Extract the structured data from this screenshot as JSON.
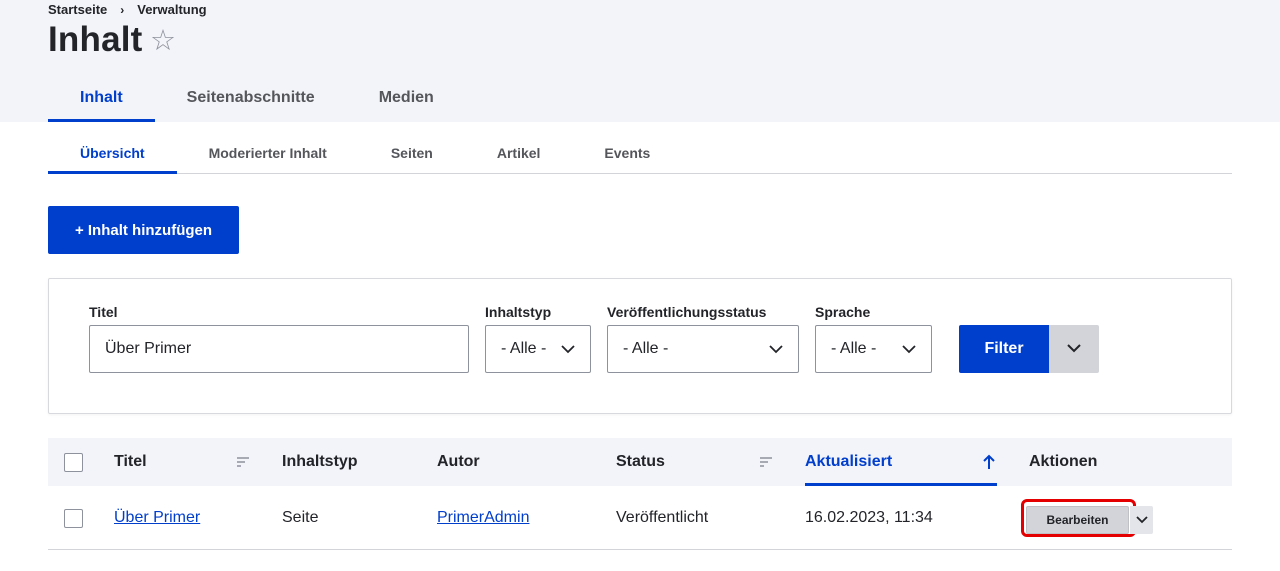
{
  "breadcrumb": {
    "home": "Startseite",
    "separator": "›",
    "current": "Verwaltung"
  },
  "page": {
    "title": "Inhalt",
    "star_glyph": "☆"
  },
  "primary_tabs": [
    {
      "label": "Inhalt",
      "active": true
    },
    {
      "label": "Seitenabschnitte",
      "active": false
    },
    {
      "label": "Medien",
      "active": false
    }
  ],
  "secondary_tabs": [
    {
      "label": "Übersicht",
      "active": true
    },
    {
      "label": "Moderierter Inhalt",
      "active": false
    },
    {
      "label": "Seiten",
      "active": false
    },
    {
      "label": "Artikel",
      "active": false
    },
    {
      "label": "Events",
      "active": false
    }
  ],
  "add_button": {
    "label": "+ Inhalt hinzufügen"
  },
  "filters": {
    "title": {
      "label": "Titel",
      "value": "Über Primer"
    },
    "type": {
      "label": "Inhaltstyp",
      "value": "- Alle -"
    },
    "status": {
      "label": "Veröffentlichungsstatus",
      "value": "- Alle -"
    },
    "language": {
      "label": "Sprache",
      "value": "- Alle -"
    },
    "submit_label": "Filter"
  },
  "table": {
    "columns": {
      "title": "Titel",
      "type": "Inhaltstyp",
      "author": "Autor",
      "status": "Status",
      "updated": "Aktualisiert",
      "actions": "Aktionen"
    },
    "rows": [
      {
        "title": "Über Primer",
        "type": "Seite",
        "author": "PrimerAdmin",
        "status": "Veröffentlicht",
        "updated": "16.02.2023, 11:34",
        "edit_label": "Bearbeiten"
      }
    ]
  },
  "colors": {
    "accent": "#003ecc",
    "header_bg": "#f3f4f9",
    "highlight": "#e40000"
  }
}
